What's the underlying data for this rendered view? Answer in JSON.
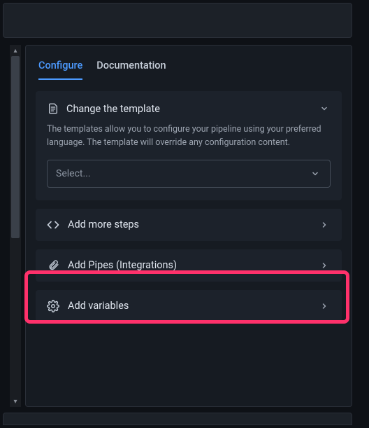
{
  "tabs": {
    "configure": "Configure",
    "documentation": "Documentation"
  },
  "template_card": {
    "title": "Change the template",
    "description": "The templates allow you to configure your pipeline using your preferred language. The template will override any configuration content.",
    "select_placeholder": "Select..."
  },
  "rows": {
    "steps": "Add more steps",
    "pipes": "Add Pipes (Integrations)",
    "variables": "Add variables"
  }
}
